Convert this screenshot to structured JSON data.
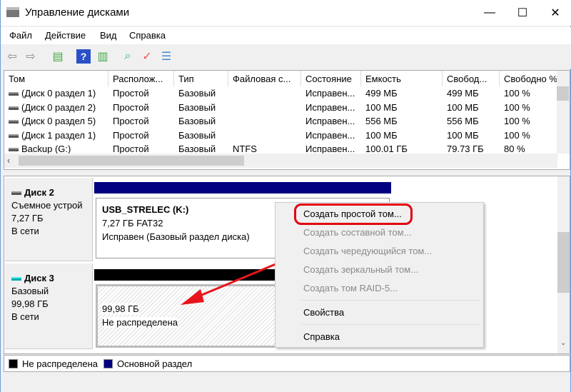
{
  "window": {
    "title": "Управление дисками",
    "minimize": "—",
    "maximize": "☐",
    "close": "✕"
  },
  "menu": [
    "Файл",
    "Действие",
    "Вид",
    "Справка"
  ],
  "list": {
    "columns": [
      "Том",
      "Располож...",
      "Тип",
      "Файловая с...",
      "Состояние",
      "Емкость",
      "Свобод...",
      "Свободно %"
    ],
    "rows": [
      [
        "(Диск 0 раздел 1)",
        "Простой",
        "Базовый",
        "",
        "Исправен...",
        "499 МБ",
        "499 МБ",
        "100 %"
      ],
      [
        "(Диск 0 раздел 2)",
        "Простой",
        "Базовый",
        "",
        "Исправен...",
        "100 МБ",
        "100 МБ",
        "100 %"
      ],
      [
        "(Диск 0 раздел 5)",
        "Простой",
        "Базовый",
        "",
        "Исправен...",
        "556 МБ",
        "556 МБ",
        "100 %"
      ],
      [
        "(Диск 1 раздел 1)",
        "Простой",
        "Базовый",
        "",
        "Исправен...",
        "100 МБ",
        "100 МБ",
        "100 %"
      ],
      [
        "Backup (G:)",
        "Простой",
        "Базовый",
        "NTFS",
        "Исправен...",
        "100.01 ГБ",
        "79.73 ГБ",
        "80 %"
      ]
    ]
  },
  "disks": [
    {
      "name": "Диск 2",
      "type": "Съемное устрой",
      "size": "7,27 ГБ",
      "status": "В сети",
      "partition": {
        "name": "USB_STRELEC  (K:)",
        "info": "7,27 ГБ FAT32",
        "state": "Исправен (Базовый раздел диска)"
      }
    },
    {
      "name": "Диск 3",
      "type": "Базовый",
      "size": "99,98 ГБ",
      "status": "В сети",
      "partition": {
        "size": "99,98 ГБ",
        "state": "Не распределена"
      }
    }
  ],
  "context_menu": [
    {
      "label": "Создать простой том...",
      "enabled": true,
      "highlighted": true
    },
    {
      "label": "Создать составной том...",
      "enabled": false
    },
    {
      "label": "Создать чередующийся том...",
      "enabled": false
    },
    {
      "label": "Создать зеркальный том...",
      "enabled": false
    },
    {
      "label": "Создать том RAID-5...",
      "enabled": false
    },
    {
      "label": "Свойства",
      "enabled": true
    },
    {
      "label": "Справка",
      "enabled": true
    }
  ],
  "legend": [
    {
      "label": "Не распределена",
      "color": "#000000"
    },
    {
      "label": "Основной раздел",
      "color": "#000080"
    }
  ],
  "colors": {
    "primary_partition": "#000080",
    "unallocated": "#000000",
    "highlight_ring": "#e3000f",
    "arrow": "#e8141b"
  }
}
